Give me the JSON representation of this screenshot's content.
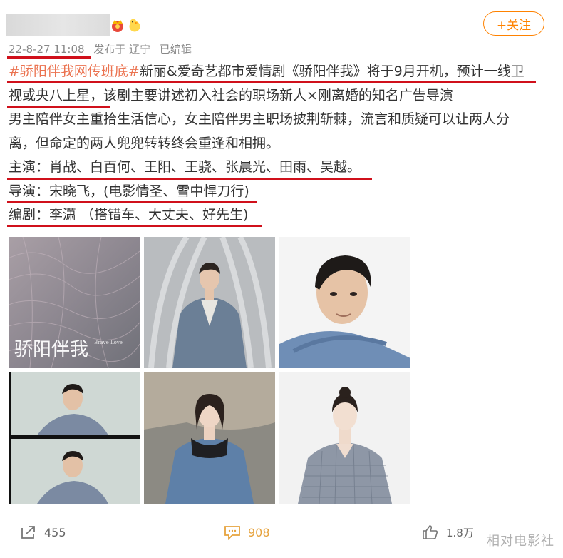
{
  "post": {
    "timestamp": "22-8-27 11:08",
    "source": "发布于 辽宁",
    "edited": "已编辑",
    "follow_label": "+关注",
    "lines": [
      {
        "hashtag": "#骄阳伴我网传班底#",
        "text": "新丽&爱奇艺都市爱情剧《骄阳伴我》将于9月开机，预计一线卫"
      },
      {
        "text": "视或央八上星，该剧主要讲述初入社会的职场新人×刚离婚的知名广告导演"
      },
      {
        "text": "男主陪伴女主重拾生活信心，女主陪伴男主职场披荆斩棘，流言和质疑可以让两人分"
      },
      {
        "text": "离，但命定的两人兜兜转转终会重逢和相拥。"
      },
      {
        "text": "主演：肖战、白百何、王阳、王骁、张晨光、田雨、吴越。"
      },
      {
        "text": "导演：宋晓飞，(电影情圣、雪中悍刀行)"
      },
      {
        "text": "编剧：李潇 （搭错车、大丈夫、好先生)"
      }
    ]
  },
  "images": {
    "poster_title": "骄阳伴我",
    "poster_subtitle": "Brave Love"
  },
  "actions": {
    "repost_count": "455",
    "comment_count": "908",
    "like_count": "1.8万"
  },
  "watermark": "相对电影社",
  "colors": {
    "accent": "#ff8200",
    "hashtag": "#eb7350",
    "underline": "#d0101b",
    "comment_icon": "#e6a23c"
  }
}
